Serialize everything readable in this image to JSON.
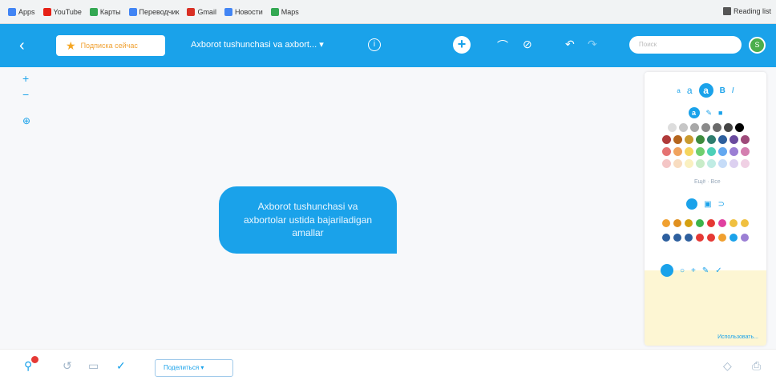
{
  "bookmarks": {
    "items": [
      {
        "label": "Apps",
        "color": "#4285f4"
      },
      {
        "label": "YouTube",
        "color": "#e62117"
      },
      {
        "label": "Карты",
        "color": "#34a853"
      },
      {
        "label": "Переводчик",
        "color": "#4285f4"
      },
      {
        "label": "Gmail",
        "color": "#d93025"
      },
      {
        "label": "Новости",
        "color": "#4285f4"
      },
      {
        "label": "Maps",
        "color": "#34a853"
      }
    ],
    "reading_list": "Reading list"
  },
  "header": {
    "back_icon": "chevron-left",
    "subscribe_label": "Подписка сейчас",
    "map_title": "Axborot tushunchasi va axbort... ▾",
    "info_icon": "i",
    "add_icon": "+",
    "search_placeholder": "Поиск",
    "avatar_initial": "S",
    "accent_color": "#1aa2ea"
  },
  "canvas": {
    "zoom_in": "+",
    "zoom_out": "−",
    "center_icon": "⊕",
    "node_text": "Axborot tushunchasi va axbortolar ustida bajariladigan amallar"
  },
  "panel": {
    "text_sizes": [
      "a",
      "a",
      "a",
      "B",
      "I"
    ],
    "color_rows": [
      [
        "#dddddd",
        "#c6c6c6",
        "#a8a8a8",
        "#8a8a8a",
        "#6a6a6a",
        "#454545",
        "#000000"
      ],
      [
        "#b03a3a",
        "#b5651d",
        "#c99a2e",
        "#3d8b3d",
        "#2e7d6e",
        "#2d5f9e",
        "#6a4a9e",
        "#9e4a7a"
      ],
      [
        "#e57373",
        "#f0a35e",
        "#f5d55e",
        "#6fcf6f",
        "#4dd0b8",
        "#64a8f0",
        "#9b7fd4",
        "#d47fb0"
      ],
      [
        "#f4c6c6",
        "#f8dcc0",
        "#faf0c0",
        "#c8ecc8",
        "#c0ece4",
        "#c6dcf8",
        "#dcd0f0",
        "#f0d0e4"
      ]
    ],
    "more_colors": "Ещё · Все",
    "icon_row_1": [
      "#f0a030",
      "#e09020",
      "#d4a010",
      "#3cb44b",
      "#e53935",
      "#e040a0",
      "#f0c040",
      "#f0c040"
    ],
    "icon_row_2": [
      "#2d5f9e",
      "#2d5f9e",
      "#2d5f9e",
      "#e53935",
      "#e53935",
      "#f0a030",
      "#1aa2ea",
      "#9b7fd4"
    ],
    "footer_link": "Использовать..."
  },
  "bottom": {
    "dropdown_label": "Поделиться ▾",
    "icons": [
      "history",
      "comment",
      "check"
    ],
    "badge_color": "#e53935"
  }
}
